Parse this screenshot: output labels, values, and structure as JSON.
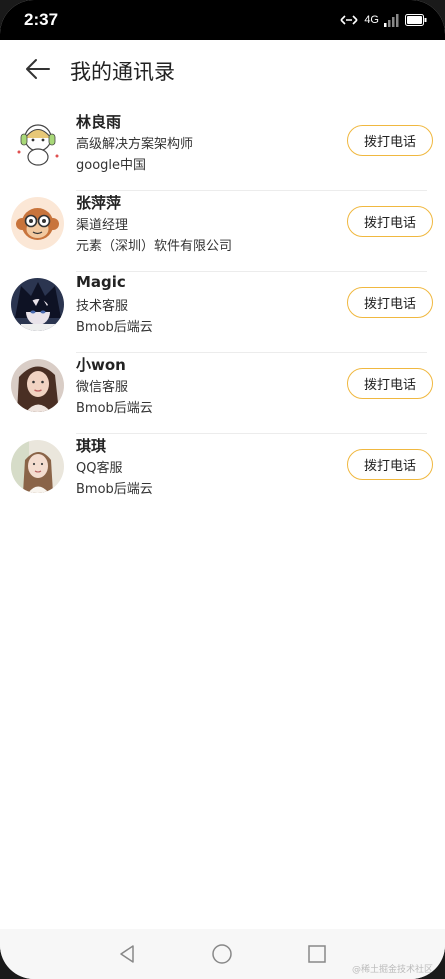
{
  "status_bar": {
    "time": "2:37",
    "network_label": "4G",
    "icons": [
      "nfc-icon",
      "signal-icon",
      "battery-icon"
    ]
  },
  "app_bar": {
    "title": "我的通讯录",
    "back_icon": "arrow-left-icon"
  },
  "contacts": [
    {
      "name": "林良雨",
      "title": "高级解决方案架构师",
      "company": "google中国",
      "call_label": "拨打电话",
      "avatar": "cartoon-bear-headphones"
    },
    {
      "name": "张萍萍",
      "title": "渠道经理",
      "company": "元素（深圳）软件有限公司",
      "call_label": "拨打电话",
      "avatar": "cartoon-monkey-glasses"
    },
    {
      "name": "Magic",
      "title": "技术客服",
      "company": "Bmob后端云",
      "call_label": "拨打电话",
      "avatar": "anime-boy"
    },
    {
      "name": "小won",
      "title": "微信客服",
      "company": "Bmob后端云",
      "call_label": "拨打电话",
      "avatar": "woman-portrait"
    },
    {
      "name": "琪琪",
      "title": "QQ客服",
      "company": "Bmob后端云",
      "call_label": "拨打电话",
      "avatar": "woman-portrait-light"
    }
  ],
  "nav_bar": {
    "icons": [
      "back-triangle-icon",
      "home-circle-icon",
      "recent-square-icon"
    ]
  },
  "watermark": "@稀土掘金技术社区",
  "colors": {
    "accent_border": "#f0b840",
    "status_bar_bg": "#000000",
    "divider": "#ececec"
  }
}
